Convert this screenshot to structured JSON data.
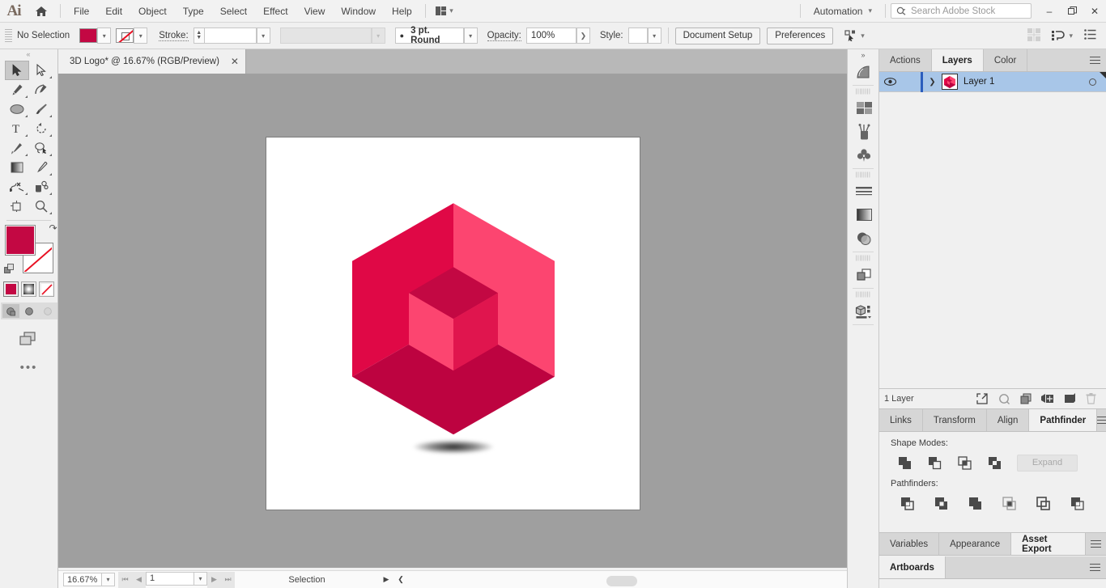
{
  "app": {
    "name": "Adobe Illustrator",
    "logo_text": "Ai",
    "home_icon": "home-icon"
  },
  "menubar": {
    "items": [
      "File",
      "Edit",
      "Object",
      "Type",
      "Select",
      "Effect",
      "View",
      "Window",
      "Help"
    ],
    "arrange_icon": "arrange-documents-icon",
    "automation_label": "Automation",
    "search": {
      "placeholder": "Search Adobe Stock",
      "value": "",
      "icon": "search-icon"
    },
    "window_controls": {
      "minimize": "–",
      "maximize": "❐",
      "close": "✕"
    }
  },
  "controlbar": {
    "selection_label": "No Selection",
    "fill_color": "#C30843",
    "stroke_color": "none",
    "stroke_label": "Stroke:",
    "stroke_weight": "",
    "stroke_profile": "",
    "brush_definition": "3 pt. Round",
    "opacity_label": "Opacity:",
    "opacity_value": "100%",
    "style_label": "Style:",
    "document_setup_label": "Document Setup",
    "preferences_label": "Preferences",
    "select_similar_icon": "select-similar-objects-icon",
    "align_icon": "align-icon",
    "distribute_icon": "distribute-icon",
    "workspace_icon": "workspace-list-icon"
  },
  "document": {
    "tab_title": "3D Logo* @ 16.67% (RGB/Preview)",
    "close_label": "✕"
  },
  "toolbar": {
    "tools": [
      {
        "name": "selection-tool",
        "glyph": "selection",
        "active": true,
        "has_flyout": false
      },
      {
        "name": "direct-selection-tool",
        "glyph": "direct-selection",
        "active": false,
        "has_flyout": true
      },
      {
        "name": "pen-tool",
        "glyph": "pen",
        "active": false,
        "has_flyout": true
      },
      {
        "name": "curvature-tool",
        "glyph": "curvature",
        "active": false,
        "has_flyout": false
      },
      {
        "name": "ellipse-tool",
        "glyph": "ellipse",
        "active": false,
        "has_flyout": true
      },
      {
        "name": "paintbrush-tool",
        "glyph": "paintbrush",
        "active": false,
        "has_flyout": true
      },
      {
        "name": "type-tool",
        "glyph": "type",
        "active": false,
        "has_flyout": true
      },
      {
        "name": "rotate-tool",
        "glyph": "rotate",
        "active": false,
        "has_flyout": true
      },
      {
        "name": "shaper-tool",
        "glyph": "shaper",
        "active": false,
        "has_flyout": true
      },
      {
        "name": "lasso-tool",
        "glyph": "lasso",
        "active": false,
        "has_flyout": true
      },
      {
        "name": "gradient-tool",
        "glyph": "gradient",
        "active": false,
        "has_flyout": false
      },
      {
        "name": "eyedropper-tool",
        "glyph": "eyedropper",
        "active": false,
        "has_flyout": true
      },
      {
        "name": "blend-tool",
        "glyph": "blend",
        "active": false,
        "has_flyout": true
      },
      {
        "name": "symbol-sprayer-tool",
        "glyph": "symbol-sprayer",
        "active": false,
        "has_flyout": true
      },
      {
        "name": "artboard-tool",
        "glyph": "artboard",
        "active": false,
        "has_flyout": false
      },
      {
        "name": "zoom-tool",
        "glyph": "zoom",
        "active": false,
        "has_flyout": true
      }
    ],
    "fill_color": "#C30843",
    "stroke_color": "#FFFFFF",
    "swap_icon": "swap-fill-stroke-icon",
    "default_icon": "default-fill-stroke-icon",
    "color_modes": [
      "color-swatch-mode",
      "gradient-mode",
      "none-mode"
    ],
    "draw_modes": [
      "draw-normal",
      "draw-behind",
      "draw-inside"
    ],
    "screen_mode_icon": "change-screen-mode-icon",
    "more_tools_label": "•••"
  },
  "canvas": {
    "background_color": "#9F9F9F",
    "artboard_color": "#FFFFFF",
    "artwork_name": "3d-hexagon-cube-logo",
    "logo_colors": {
      "outer_left": "#E00846",
      "outer_right": "#FC4570",
      "outer_bottom": "#BD0340",
      "inner_top": "#C30843",
      "inner_left": "#FC4570",
      "inner_right": "#E0154E"
    },
    "shadow_name": "drop-shadow-ellipse"
  },
  "statusbar": {
    "zoom_level": "16.67%",
    "artboard_number": "1",
    "status_text": "Selection",
    "first_icon": "first-artboard-icon",
    "prev_icon": "previous-artboard-icon",
    "next_icon": "next-artboard-icon",
    "last_icon": "last-artboard-icon"
  },
  "icon_rail": {
    "items": [
      "properties-panel-icon",
      "swatches-panel-icon",
      "brushes-panel-icon",
      "symbols-panel-icon",
      "stroke-panel-icon",
      "gradient-panel-icon",
      "transparency-panel-icon",
      "pathfinder-panel-icon",
      "asset-export-panel-icon"
    ],
    "collapse_icon": "collapse-panels-icon"
  },
  "panels": {
    "group1": {
      "tabs": [
        {
          "label": "Actions",
          "active": false
        },
        {
          "label": "Layers",
          "active": true
        },
        {
          "label": "Color",
          "active": false
        }
      ],
      "menu_icon": "panel-menu-icon",
      "layers": [
        {
          "name": "Layer 1",
          "visible": true,
          "locked": false,
          "selected": true,
          "color": "#2B5DBD",
          "thumbnail": "layer-thumbnail"
        }
      ],
      "footer": {
        "count_label": "1 Layer",
        "icons": [
          "locate-object-icon",
          "make-clipping-mask-icon",
          "create-new-sublayer-icon",
          "create-new-layer-icon",
          "delete-selection-icon"
        ]
      }
    },
    "group2": {
      "tabs": [
        {
          "label": "Links",
          "active": false
        },
        {
          "label": "Transform",
          "active": false
        },
        {
          "label": "Align",
          "active": false
        },
        {
          "label": "Pathfinder",
          "active": true
        }
      ],
      "menu_icon": "panel-menu-icon",
      "shape_modes_label": "Shape Modes:",
      "shape_modes": [
        "unite-icon",
        "minus-front-icon",
        "intersect-icon",
        "exclude-icon"
      ],
      "expand_label": "Expand",
      "pathfinders_label": "Pathfinders:",
      "pathfinders": [
        "divide-icon",
        "trim-icon",
        "merge-icon",
        "crop-icon",
        "outline-icon",
        "minus-back-icon"
      ]
    },
    "group3": {
      "tabs": [
        {
          "label": "Variables",
          "active": false
        },
        {
          "label": "Appearance",
          "active": false
        },
        {
          "label": "Asset Export",
          "active": true
        }
      ],
      "menu_icon": "panel-menu-icon"
    },
    "group4": {
      "tabs": [
        {
          "label": "Artboards",
          "active": true
        }
      ],
      "menu_icon": "panel-menu-icon"
    }
  }
}
